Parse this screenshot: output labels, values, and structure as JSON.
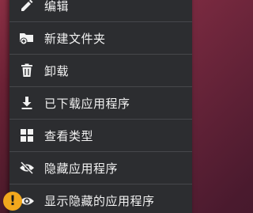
{
  "menu": {
    "items": [
      {
        "label": "编辑",
        "icon": "pencil-icon"
      },
      {
        "label": "新建文件夹",
        "icon": "new-folder-icon"
      },
      {
        "label": "卸载",
        "icon": "trash-icon"
      },
      {
        "label": "已下载应用程序",
        "icon": "download-icon"
      },
      {
        "label": "查看类型",
        "icon": "grid-view-icon"
      },
      {
        "label": "隐藏应用程序",
        "icon": "eye-off-icon"
      },
      {
        "label": "显示隐藏的应用程序",
        "icon": "eye-icon"
      }
    ]
  },
  "warning_badge": {
    "symbol": "!",
    "icon": "warning-icon",
    "color": "#f2a81d"
  },
  "colors": {
    "menu_bg": "#2c2d30",
    "divider": "#46474b",
    "text": "#f2f2f2"
  }
}
